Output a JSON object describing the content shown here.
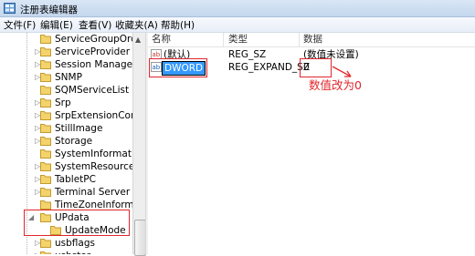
{
  "window": {
    "title": "注册表编辑器"
  },
  "menu": [
    "文件(F)",
    "编辑(E)",
    "查看(V)",
    "收藏夹(A)",
    "帮助(H)"
  ],
  "tree": {
    "items": [
      {
        "label": "ServiceGroupOrder",
        "expander": ""
      },
      {
        "label": "ServiceProvider",
        "expander": "▷"
      },
      {
        "label": "Session Manager",
        "expander": "▷"
      },
      {
        "label": "SNMP",
        "expander": "▷"
      },
      {
        "label": "SQMServiceList",
        "expander": ""
      },
      {
        "label": "Srp",
        "expander": "▷"
      },
      {
        "label": "SrpExtensionConfig",
        "expander": "▷"
      },
      {
        "label": "StillImage",
        "expander": "▷"
      },
      {
        "label": "Storage",
        "expander": "▷"
      },
      {
        "label": "SystemInformation",
        "expander": ""
      },
      {
        "label": "SystemResources",
        "expander": "▷"
      },
      {
        "label": "TabletPC",
        "expander": "▷"
      },
      {
        "label": "Terminal Server",
        "expander": "▷"
      },
      {
        "label": "TimeZoneInformation",
        "expander": ""
      },
      {
        "label": "UPdata",
        "expander": "◢"
      },
      {
        "label": "UpdateMode",
        "expander": ""
      },
      {
        "label": "usbflags",
        "expander": "▷"
      },
      {
        "label": "usbstor",
        "expander": "▷"
      }
    ]
  },
  "list": {
    "headers": {
      "name": "名称",
      "type": "类型",
      "data": "数据"
    },
    "rows": [
      {
        "name": "(默认)",
        "type": "REG_SZ",
        "data": "(数值未设置)"
      },
      {
        "name": "DWORD",
        "type": "REG_EXPAND_SZ",
        "data": "0"
      }
    ]
  },
  "annotation": {
    "text": "数值改为0"
  },
  "colors": {
    "annotation": "#e0262b",
    "selection": "#3399ff"
  }
}
